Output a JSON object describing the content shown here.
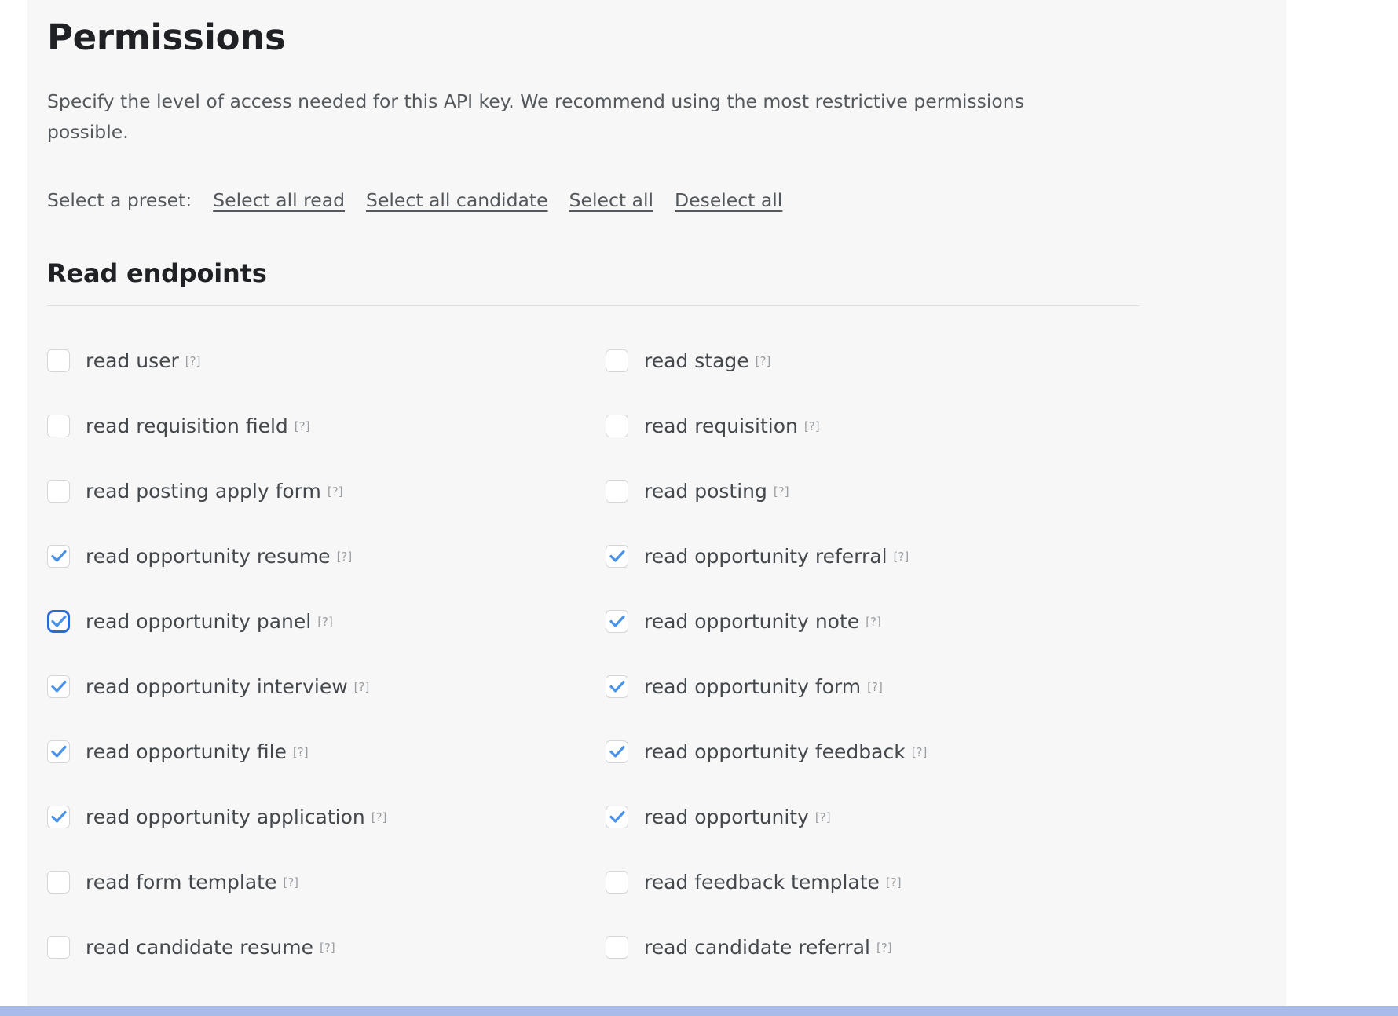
{
  "page": {
    "title": "Permissions",
    "description": "Specify the level of access needed for this API key. We recommend using the most restrictive permissions possible."
  },
  "presets": {
    "label": "Select a preset:",
    "links": [
      "Select all read",
      "Select all candidate",
      "Select all",
      "Deselect all"
    ]
  },
  "sections": [
    {
      "title": "Read endpoints",
      "help_marker": "[?]",
      "rows": [
        {
          "left": {
            "label": "read user",
            "checked": false,
            "focused": false
          },
          "right": {
            "label": "read stage",
            "checked": false,
            "focused": false
          }
        },
        {
          "left": {
            "label": "read requisition field",
            "checked": false,
            "focused": false
          },
          "right": {
            "label": "read requisition",
            "checked": false,
            "focused": false
          }
        },
        {
          "left": {
            "label": "read posting apply form",
            "checked": false,
            "focused": false
          },
          "right": {
            "label": "read posting",
            "checked": false,
            "focused": false
          }
        },
        {
          "left": {
            "label": "read opportunity resume",
            "checked": true,
            "focused": false
          },
          "right": {
            "label": "read opportunity referral",
            "checked": true,
            "focused": false
          }
        },
        {
          "left": {
            "label": "read opportunity panel",
            "checked": true,
            "focused": true
          },
          "right": {
            "label": "read opportunity note",
            "checked": true,
            "focused": false
          }
        },
        {
          "left": {
            "label": "read opportunity interview",
            "checked": true,
            "focused": false
          },
          "right": {
            "label": "read opportunity form",
            "checked": true,
            "focused": false
          }
        },
        {
          "left": {
            "label": "read opportunity file",
            "checked": true,
            "focused": false
          },
          "right": {
            "label": "read opportunity feedback",
            "checked": true,
            "focused": false
          }
        },
        {
          "left": {
            "label": "read opportunity application",
            "checked": true,
            "focused": false
          },
          "right": {
            "label": "read opportunity",
            "checked": true,
            "focused": false
          }
        },
        {
          "left": {
            "label": "read form template",
            "checked": false,
            "focused": false
          },
          "right": {
            "label": "read feedback template",
            "checked": false,
            "focused": false
          }
        },
        {
          "left": {
            "label": "read candidate resume",
            "checked": false,
            "focused": false
          },
          "right": {
            "label": "read candidate referral",
            "checked": false,
            "focused": false
          }
        }
      ]
    }
  ],
  "colors": {
    "page_background": "#ffffff",
    "panel_background": "#f7f7f7",
    "heading": "#1f2124",
    "body_text": "#54585c",
    "label_text": "#44484c",
    "checkbox_border": "#d6d6d6",
    "check_mark": "#4a93e8",
    "focus_ring": "#2a6ad4",
    "divider": "#dedede",
    "bottom_bar": "#a9bce9"
  }
}
